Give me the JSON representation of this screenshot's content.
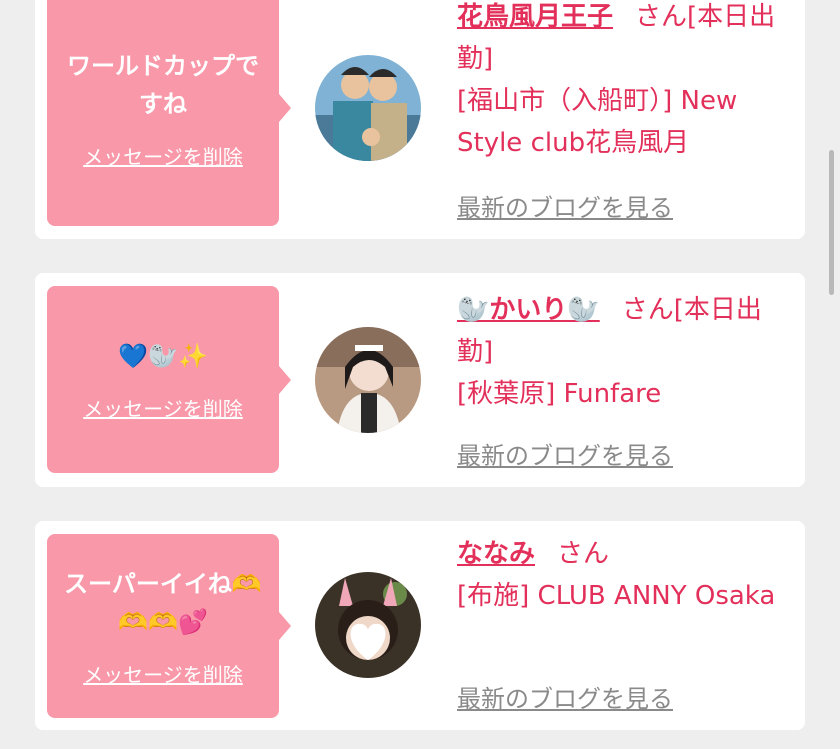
{
  "items": [
    {
      "message": "ワールドカップですね",
      "delete_label": "メッセージを削除",
      "name": "花鳥風月王子",
      "san": "さん",
      "status": "[本日出勤]",
      "shop_line": "[福山市（入船町）] New Style club花鳥風月",
      "blog_label": "最新のブログを見る"
    },
    {
      "message": "💙🦭✨",
      "delete_label": "メッセージを削除",
      "name": "🦭かいり🦭",
      "san": "さん",
      "status": "[本日出勤]",
      "shop_line": "[秋葉原] Funfare",
      "blog_label": "最新のブログを見る"
    },
    {
      "message": "スーパーイイね🫶🫶🫶💕",
      "delete_label": "メッセージを削除",
      "name": "ななみ",
      "san": "さん",
      "status": "",
      "shop_line": "[布施] CLUB ANNY Osaka",
      "blog_label": "最新のブログを見る"
    }
  ]
}
